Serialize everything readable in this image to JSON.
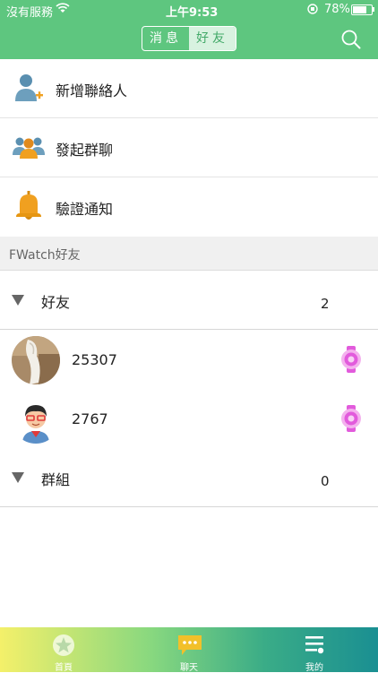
{
  "status_bar": {
    "carrier": "沒有服務",
    "time": "上午9:53",
    "battery": "78%",
    "battery_level": 0.78
  },
  "header": {
    "tabs": [
      {
        "label": "消息",
        "active": false
      },
      {
        "label": "好友",
        "active": true
      }
    ],
    "icons": [
      "search-icon"
    ]
  },
  "menu": [
    {
      "label": "新增聯絡人",
      "icon": "add-contact-icon"
    },
    {
      "label": "發起群聊",
      "icon": "group-chat-icon"
    },
    {
      "label": "驗證通知",
      "icon": "bell-icon"
    }
  ],
  "section": {
    "title": "FWatch好友"
  },
  "groups": [
    {
      "label": "好友",
      "count": "2"
    },
    {
      "label": "群組",
      "count": "0"
    }
  ],
  "friends": [
    {
      "name": "25307",
      "avatar": "photo-avatar",
      "device_icon": "watch-icon"
    },
    {
      "name": "2767",
      "avatar": "cartoon-avatar",
      "device_icon": "watch-icon"
    }
  ],
  "tabbar": [
    {
      "label": "首頁",
      "icon": "home-icon"
    },
    {
      "label": "聊天",
      "icon": "chat-icon"
    },
    {
      "label": "我的",
      "icon": "menu-icon"
    }
  ],
  "colors": {
    "header": "#5ec67f",
    "watch": "#e25bdc",
    "bell": "#f0a020",
    "contact": "#5a8fb0"
  }
}
